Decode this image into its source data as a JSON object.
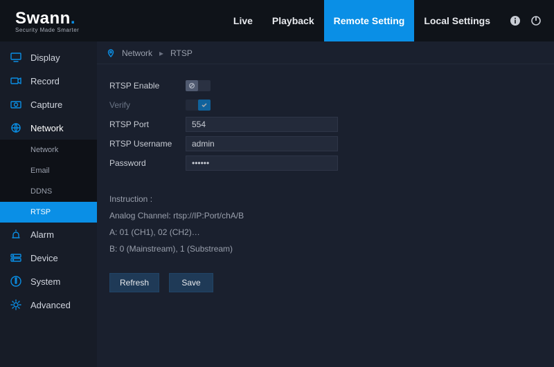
{
  "brand": {
    "name": "Swann",
    "tagline": "Security Made Smarter"
  },
  "nav": {
    "items": [
      {
        "label": "Live"
      },
      {
        "label": "Playback"
      },
      {
        "label": "Remote Setting"
      },
      {
        "label": "Local Settings"
      }
    ]
  },
  "sidebar": {
    "items": [
      {
        "label": "Display"
      },
      {
        "label": "Record"
      },
      {
        "label": "Capture"
      },
      {
        "label": "Network"
      },
      {
        "label": "Alarm"
      },
      {
        "label": "Device"
      },
      {
        "label": "System"
      },
      {
        "label": "Advanced"
      }
    ],
    "network_sub": [
      {
        "label": "Network"
      },
      {
        "label": "Email"
      },
      {
        "label": "DDNS"
      },
      {
        "label": "RTSP"
      }
    ]
  },
  "breadcrumbs": {
    "a": "Network",
    "b": "RTSP"
  },
  "form": {
    "rtsp_enable_label": "RTSP Enable",
    "rtsp_enable": false,
    "verify_label": "Verify",
    "verify": true,
    "port_label": "RTSP Port",
    "port": "554",
    "user_label": "RTSP Username",
    "user": "admin",
    "pass_label": "Password",
    "pass": "••••••"
  },
  "instruction": {
    "title": "Instruction :",
    "l1": "Analog Channel: rtsp://IP:Port/chA/B",
    "l2": "A: 01 (CH1), 02 (CH2)…",
    "l3": "B: 0 (Mainstream), 1 (Substream)"
  },
  "buttons": {
    "refresh": "Refresh",
    "save": "Save"
  }
}
